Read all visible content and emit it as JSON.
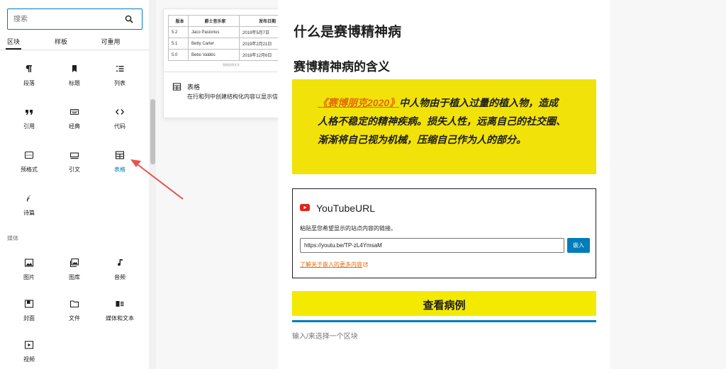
{
  "inserter": {
    "search_placeholder": "搜索",
    "tabs": [
      "区块",
      "样板",
      "可重用"
    ],
    "text_blocks": [
      {
        "label": "段落",
        "icon": "paragraph-icon"
      },
      {
        "label": "标题",
        "icon": "bookmark-icon"
      },
      {
        "label": "列表",
        "icon": "list-icon"
      },
      {
        "label": "引用",
        "icon": "quote-icon"
      },
      {
        "label": "经典",
        "icon": "keyboard-icon"
      },
      {
        "label": "代码",
        "icon": "code-icon"
      },
      {
        "label": "预格式",
        "icon": "preformatted-icon"
      },
      {
        "label": "引文",
        "icon": "pullquote-icon"
      },
      {
        "label": "表格",
        "icon": "table-icon"
      },
      {
        "label": "诗篇",
        "icon": "verse-icon"
      }
    ],
    "media_section_label": "媒体",
    "media_blocks": [
      {
        "label": "图片",
        "icon": "image-icon"
      },
      {
        "label": "图库",
        "icon": "gallery-icon"
      },
      {
        "label": "音频",
        "icon": "audio-icon"
      },
      {
        "label": "封面",
        "icon": "cover-icon"
      },
      {
        "label": "文件",
        "icon": "folder-icon"
      },
      {
        "label": "媒体和文本",
        "icon": "media-text-icon"
      },
      {
        "label": "视频",
        "icon": "video-icon"
      }
    ],
    "highlight_color": "#007cba"
  },
  "preview": {
    "table_headers": [
      "版本",
      "爵士音乐家",
      "发布日期"
    ],
    "table_rows": [
      [
        "5.2",
        "Jaco Pastorius",
        "2019年5月7日"
      ],
      [
        "5.1",
        "Betty Carter",
        "2019年2月21日"
      ],
      [
        "5.0",
        "Bebo Valdés",
        "2018年12月6日"
      ]
    ],
    "caption": "表格说明文字",
    "title": "表格",
    "description": "在行和列中创建结构化内容以显示信息。"
  },
  "editor": {
    "heading1": "什么是赛博精神病",
    "heading2": "赛博精神病的含义",
    "quote_link": "《赛博朋克2020》",
    "quote_text": "中人物由于植入过量的植入物，造成人格不稳定的精神疾病。损失人性，远离自己的社交圈、渐渐将自己视为机械，压缩自己作为人的部分。",
    "quote_bg": "#f1e20a",
    "embed": {
      "title": "YouTubeURL",
      "help": "粘贴至您希望显示的站点内容的链接。",
      "url_value": "https://youtu.be/TP-zL4YmsaM",
      "button_label": "嵌入",
      "learn_more": "了解关于嵌入的更多内容"
    },
    "cta_label": "查看病例",
    "cta_bg": "#f3ea00",
    "appender_placeholder": "输入/来选择一个区块"
  }
}
